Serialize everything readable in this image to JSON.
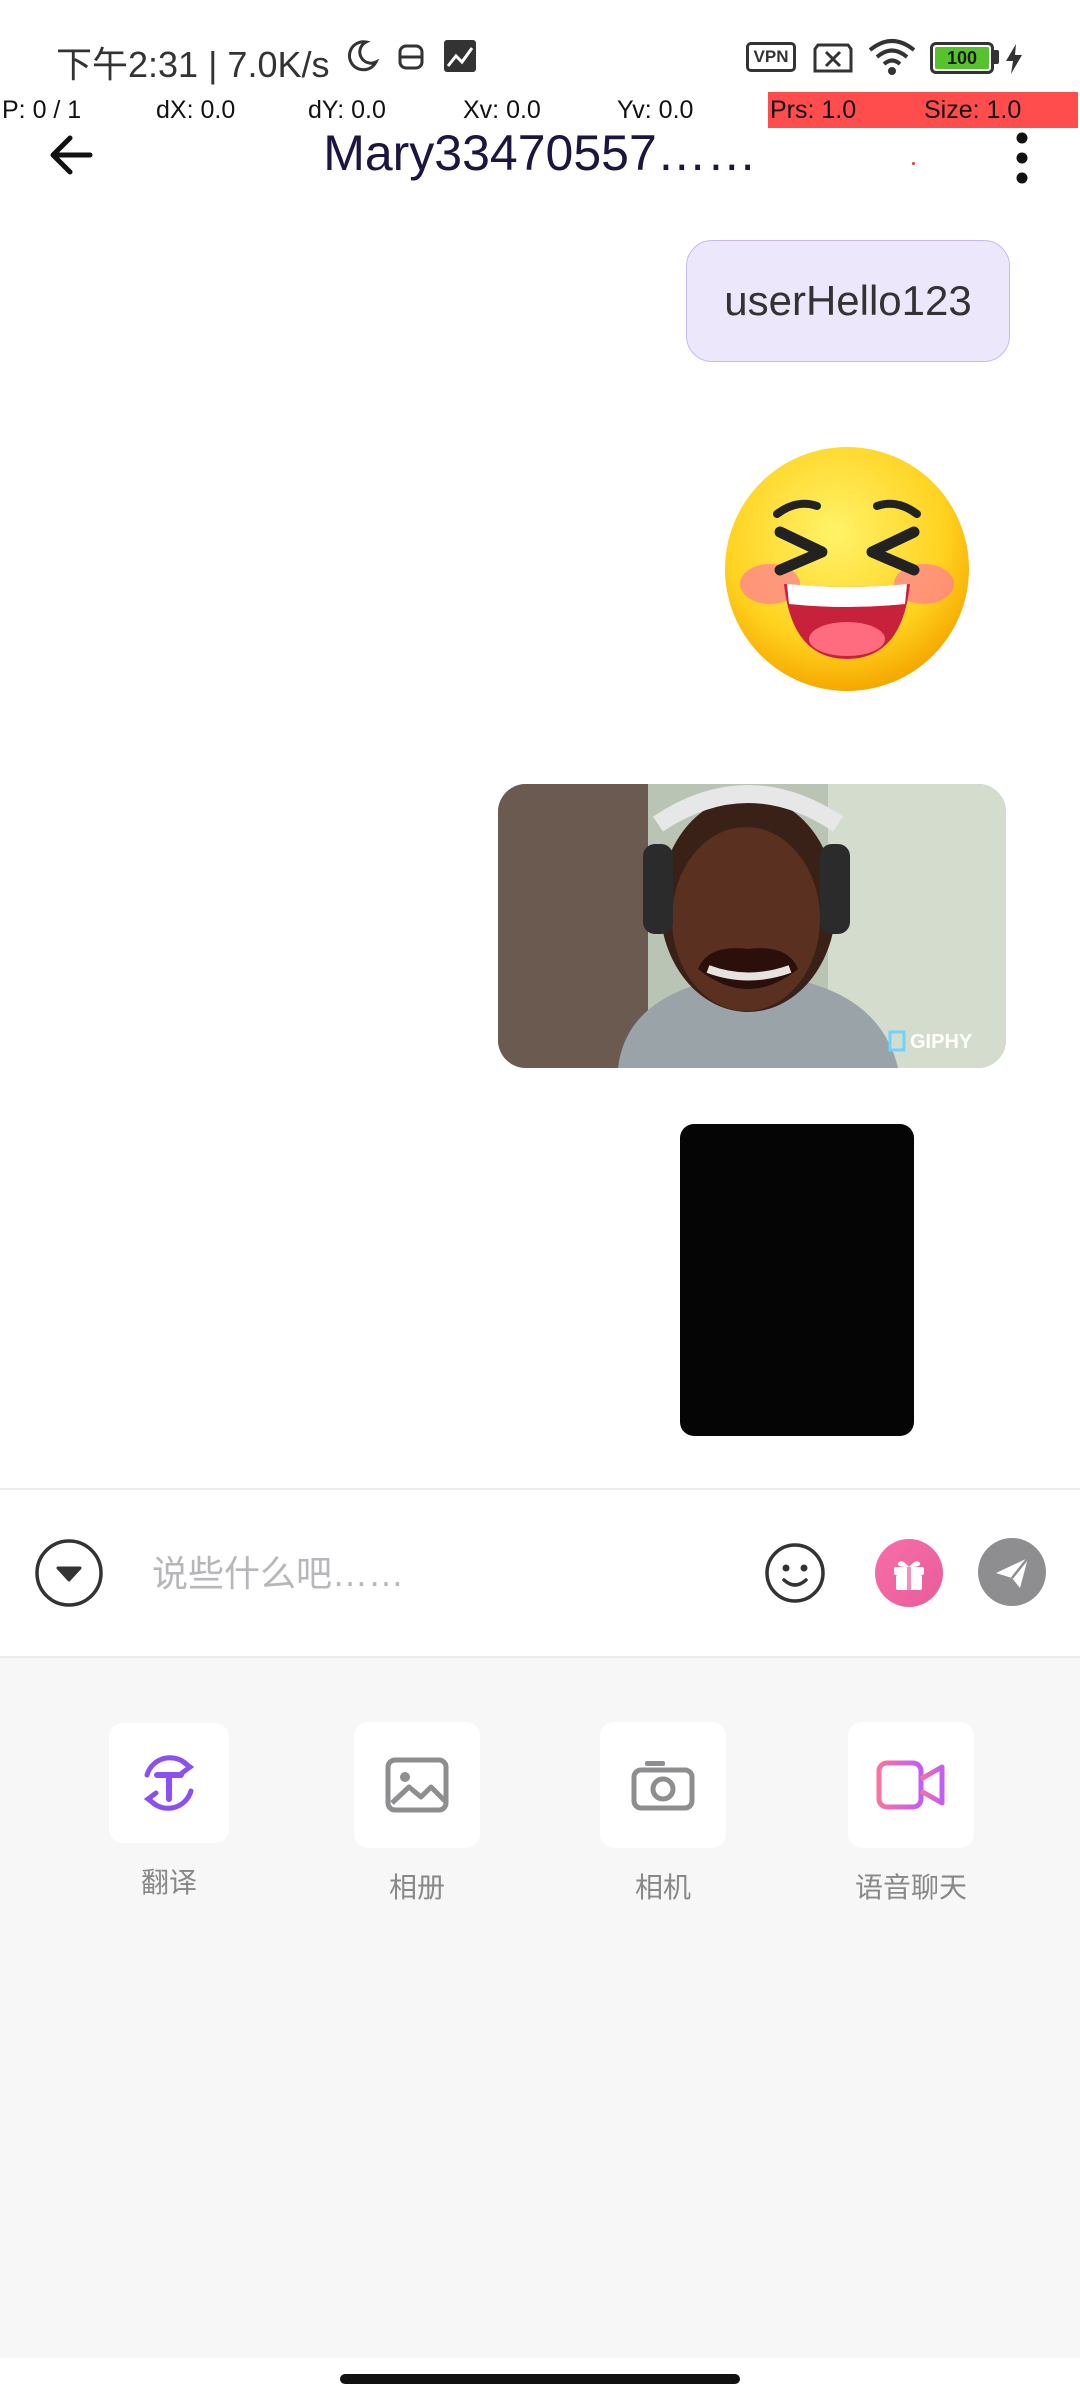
{
  "status_bar": {
    "left_text": "下午2:31 | 7.0K/s",
    "vpn_label": "VPN",
    "battery": "100"
  },
  "debug": {
    "p": "P: 0 / 1",
    "dx": "dX: 0.0",
    "dy": "dY: 0.0",
    "xv": "Xv: 0.0",
    "yv": "Yv: 0.0",
    "prs": "Prs: 1.0",
    "size": "Size: 1.0"
  },
  "header": {
    "title": "Mary33470557……"
  },
  "messages": {
    "text_1": "userHello123",
    "gif_watermark": "GIPHY"
  },
  "input": {
    "placeholder": "说些什么吧……"
  },
  "tools": {
    "translate": "翻译",
    "album": "相册",
    "camera": "相机",
    "voice_chat": "语音聊天"
  },
  "colors": {
    "accent": "#8c4ff0",
    "bubble_bg": "#ede7fb",
    "gift_gradient_start": "#f96ea8",
    "video_gradient_start": "#f9739c",
    "video_gradient_end": "#c45cf6"
  }
}
